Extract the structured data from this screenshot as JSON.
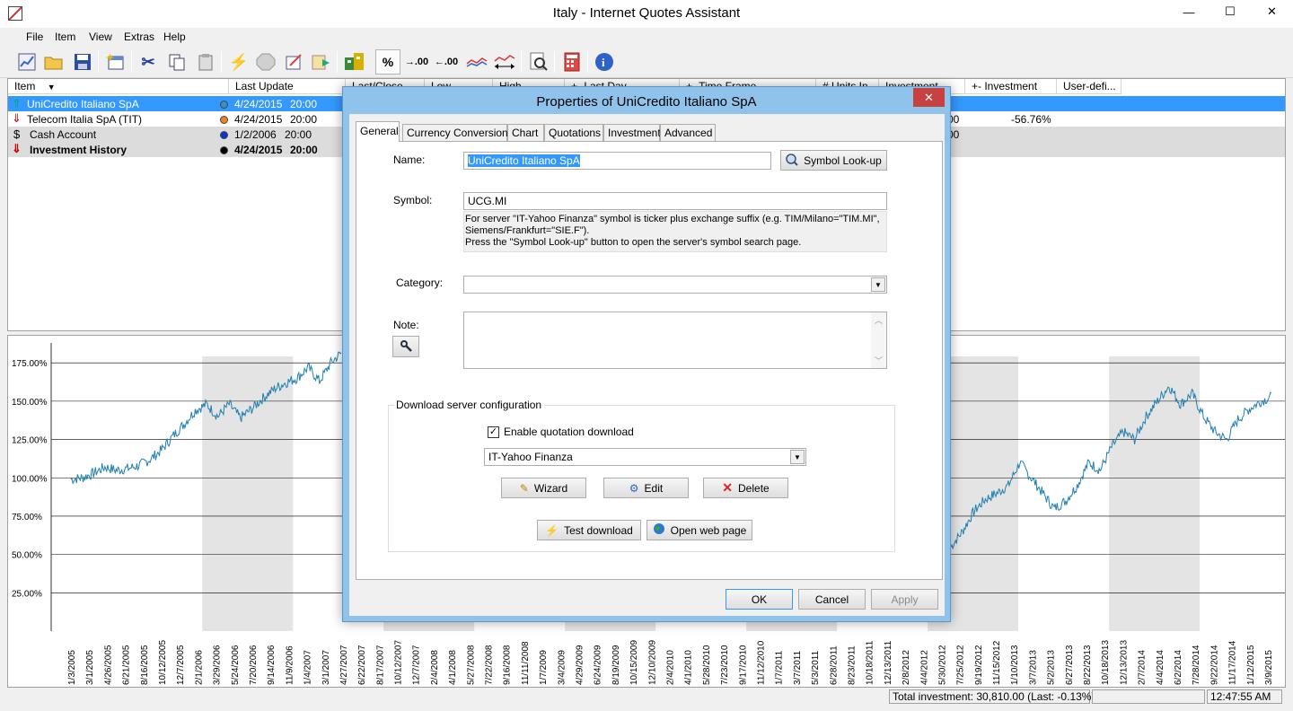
{
  "window": {
    "title": "Italy - Internet Quotes Assistant",
    "minimize": "—",
    "maximize": "☐",
    "close": "✕"
  },
  "menu": [
    "File",
    "Item",
    "View",
    "Extras",
    "Help"
  ],
  "toolbar": {
    "percent": "%",
    "decimals_more": ".00",
    "decimals_less": ".00"
  },
  "columns": [
    "Item",
    "Last Update",
    "Last/Close",
    "Low",
    "High",
    "+- Last Day",
    "+- Time Frame",
    "# Units In",
    "Investment",
    "+- Investment",
    "User-defi..."
  ],
  "rows": [
    {
      "name": "UniCredito Italiano SpA",
      "date": "4/24/2015",
      "time": "20:00",
      "extra": "",
      "extra2": ""
    },
    {
      "name": "Telecom Italia SpA (TIT)",
      "date": "4/24/2015",
      "time": "20:00",
      "extra": "00",
      "extra2": "-56.76%"
    },
    {
      "name": "Cash Account",
      "date": "1/2/2006",
      "time": "20:00",
      "extra": "00",
      "extra2": ""
    },
    {
      "name": "Investment History",
      "date": "4/24/2015",
      "time": "20:00",
      "extra": "",
      "extra2": ""
    }
  ],
  "chart_data": {
    "type": "line",
    "y_tick_labels": [
      "175.00%",
      "150.00%",
      "125.00%",
      "100.00%",
      "75.00%",
      "50.00%",
      "25.00%"
    ],
    "y_ticks": [
      175,
      150,
      125,
      100,
      75,
      50,
      25
    ],
    "ylim": [
      0,
      188
    ],
    "x_tick_labels": [
      "1/3/2005",
      "3/1/2005",
      "4/26/2005",
      "6/21/2005",
      "8/16/2005",
      "10/12/2005",
      "12/7/2005",
      "2/1/2006",
      "3/29/2006",
      "5/24/2006",
      "7/20/2006",
      "9/14/2006",
      "11/9/2006",
      "1/4/2007",
      "3/1/2007",
      "4/27/2007",
      "6/22/2007",
      "8/17/2007",
      "10/12/2007",
      "12/7/2007",
      "2/4/2008",
      "4/1/2008",
      "5/27/2008",
      "7/22/2008",
      "9/16/2008",
      "11/11/2008",
      "1/7/2009",
      "3/4/2009",
      "4/29/2009",
      "6/24/2009",
      "8/19/2009",
      "10/15/2009",
      "12/10/2009",
      "2/4/2010",
      "4/1/2010",
      "5/28/2010",
      "7/23/2010",
      "9/17/2010",
      "11/12/2010",
      "1/7/2011",
      "3/7/2011",
      "5/3/2011",
      "6/28/2011",
      "8/23/2011",
      "10/18/2011",
      "12/13/2011",
      "2/8/2012",
      "4/4/2012",
      "5/30/2012",
      "7/25/2012",
      "9/19/2012",
      "11/15/2012",
      "1/10/2013",
      "3/7/2013",
      "5/2/2013",
      "6/27/2013",
      "8/22/2013",
      "10/18/2013",
      "12/13/2013",
      "2/7/2014",
      "4/4/2014",
      "6/2/2014",
      "7/28/2014",
      "9/22/2014",
      "11/17/2014",
      "1/12/2015",
      "3/9/2015"
    ],
    "series": [
      {
        "values_left": [
          99,
          100,
          103,
          107,
          105,
          106,
          108,
          112,
          118,
          127,
          135,
          144,
          148,
          140,
          148,
          139,
          145,
          152,
          158,
          162,
          165,
          172,
          163,
          175,
          182
        ]
      },
      {
        "values_right": [
          55,
          65,
          78,
          86,
          90,
          95,
          110,
          100,
          90,
          80,
          85,
          95,
          110,
          105,
          120,
          130,
          125,
          140,
          150,
          160,
          148,
          155,
          140,
          130,
          125,
          138,
          145,
          150,
          153
        ]
      }
    ],
    "grid": true
  },
  "status": {
    "total": "Total investment: 30,810.00 (Last: -0.13%)",
    "time": "12:47:55 AM"
  },
  "dialog": {
    "title": "Properties of UniCredito Italiano SpA",
    "close": "✕",
    "tabs": [
      "General",
      "Currency Conversion",
      "Chart",
      "Quotations",
      "Investment",
      "Advanced"
    ],
    "name_label": "Name:",
    "name_value": "UniCredito Italiano SpA",
    "symbol_lookup": "Symbol Look-up",
    "symbol_label": "Symbol:",
    "symbol_value": "UCG.MI",
    "hint1": "For server \"IT-Yahoo Finanza\" symbol is ticker plus exchange suffix (e.g. TIM/Milano=\"TIM.MI\",",
    "hint2": "Siemens/Frankfurt=\"SIE.F\").",
    "hint3": "Press the \"Symbol Look-up\" button to open the server's symbol search page.",
    "category_label": "Category:",
    "category_value": "",
    "note_label": "Note:",
    "download_group": "Download server configuration",
    "enable_download": "Enable quotation download",
    "server_value": "IT-Yahoo Finanza",
    "wizard": "Wizard",
    "edit": "Edit",
    "delete": "Delete",
    "test_download": "Test download",
    "open_web_page": "Open web page",
    "ok": "OK",
    "cancel": "Cancel",
    "apply": "Apply"
  }
}
